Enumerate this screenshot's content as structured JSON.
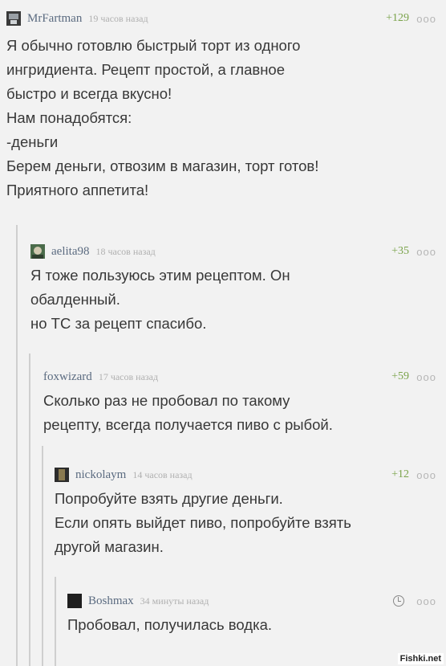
{
  "comments": [
    {
      "author": "MrFartman",
      "time": "19 часов назад",
      "rating": "+129",
      "menu": "ооо",
      "text": "Я обычно готовлю быстрый торт из одного\nингридиента. Рецепт простой, а главное\nбыстро и всегда вкусно!\nНам понадобятся:\n-деньги\nБерем деньги, отвозим в магазин, торт готов!\nПриятного аппетита!"
    },
    {
      "author": "aelita98",
      "time": "18 часов назад",
      "rating": "+35",
      "menu": "ооо",
      "text": "Я тоже пользуюсь этим рецептом. Он\nобалденный.\nно ТС за рецепт спасибо."
    },
    {
      "author": "foxwizard",
      "time": "17 часов назад",
      "rating": "+59",
      "menu": "ооо",
      "text": "Сколько раз не пробовал по такому\nрецепту, всегда получается пиво с рыбой."
    },
    {
      "author": "nickolaym",
      "time": "14 часов назад",
      "rating": "+12",
      "menu": "ооо",
      "text": "Попробуйте взять другие деньги.\nЕсли опять выйдет пиво, попробуйте взять\nдругой магазин."
    },
    {
      "author": "Boshmax",
      "time": "34 минуты назад",
      "menu": "ооо",
      "text": "Пробовал, получилась водка."
    }
  ],
  "watermark": "Fishki.net"
}
